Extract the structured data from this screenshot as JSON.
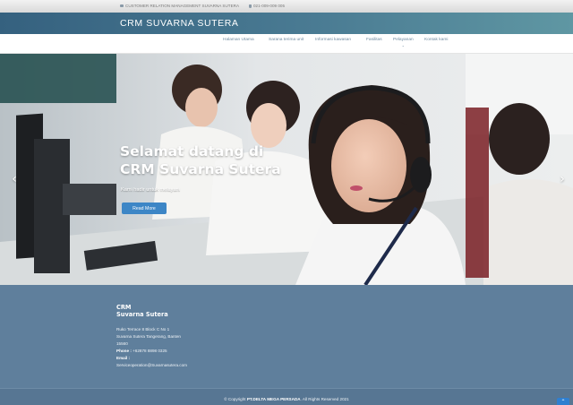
{
  "topbar": {
    "tagline": "CUSTOMER RELATION MANAGEMENT SUVARNA SUTERA",
    "phone": "021-009-009 005"
  },
  "header": {
    "brand": "CRM SUVARNA SUTERA"
  },
  "nav": {
    "items": [
      "Halaman Utama",
      "Sarana terima unit",
      "Informasi kawasan",
      "Fasilitas",
      "Pelayanan",
      "Kontak kami"
    ],
    "dropdown_caret": "⌄"
  },
  "hero": {
    "title_line1": "Selamat datang di",
    "title_line2": "CRM Suvarna Sutera",
    "subtitle": "Kami hadir untuk melayani",
    "button_label": "Read More",
    "prev_arrow": "‹",
    "next_arrow": "›"
  },
  "footer": {
    "name_line1": "CRM",
    "name_line2": "Suvarna Sutera",
    "address_line1": "Ruko Terrace 8 Block C No 1",
    "address_line2": "Suvarna Sutera Tangerang, Banten",
    "postal_code": "15560",
    "phone_label": "Phone :",
    "phone_value": "+62878 8898 0325",
    "email_label": "Email :",
    "email_value": "Serviceoperation@Suvarnasutera.com"
  },
  "copyright": {
    "prefix": "© Copyright",
    "company": "PT.DELTA MEGA PERSADA",
    "suffix": ". All Rights Reserved 2021"
  },
  "back_to_top": "⌃",
  "icons": {
    "topbar_tagline": "envelope-icon",
    "topbar_phone": "phone-icon"
  },
  "colors": {
    "brand_bar": "#4a7b93",
    "footer": "#5f7f9c",
    "nav_text": "#6f8aa0",
    "button": "#3d86c6"
  }
}
